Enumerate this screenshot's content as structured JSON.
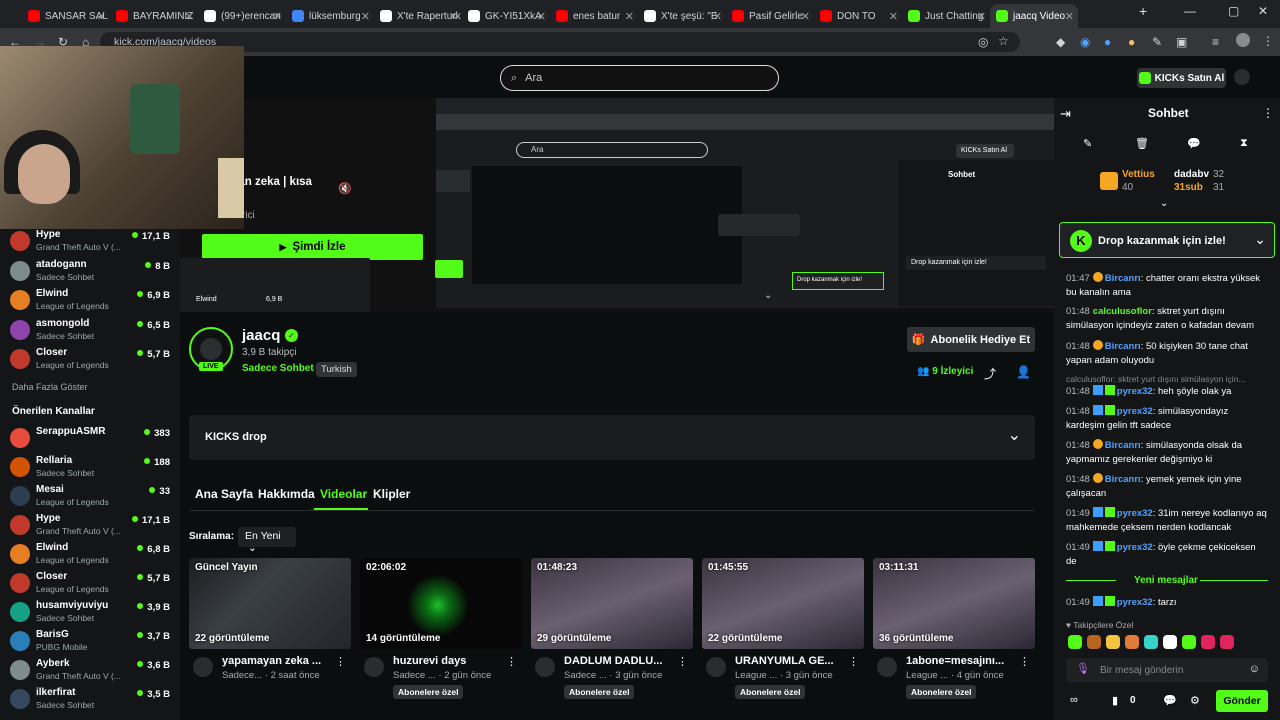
{
  "browser": {
    "tabs": [
      {
        "label": "SANSAR SAL",
        "color": "#ff0000"
      },
      {
        "label": "BAYRAMINIZ",
        "color": "#ff0000"
      },
      {
        "label": "(99+)erencan",
        "color": "#ffffff"
      },
      {
        "label": "lüksemburg",
        "color": "#4285f4"
      },
      {
        "label": "X'te Raperturk",
        "color": "#ffffff"
      },
      {
        "label": "GK-YI51XkA",
        "color": "#ffffff"
      },
      {
        "label": "enes batur",
        "color": "#ff0000"
      },
      {
        "label": "X'te şeşü: \"E",
        "color": "#ffffff"
      },
      {
        "label": "Pasif Gelirle",
        "color": "#ff0000"
      },
      {
        "label": "DON TO",
        "color": "#ff0000"
      },
      {
        "label": "Just Chatting",
        "color": "#53fc18"
      },
      {
        "label": "jaacq Video",
        "color": "#53fc18"
      }
    ],
    "url": "kick.com/jaacq/videos"
  },
  "header": {
    "search_placeholder": "Ara",
    "buy_kicks": "KICKs Satın Al"
  },
  "sidebar": {
    "followed": [
      {
        "name": "Hype",
        "game": "Grand Theft Auto V (...",
        "viewers": "17,1 B",
        "color": "#c0392b"
      },
      {
        "name": "atadogann",
        "game": "Sadece Sohbet",
        "viewers": "8 B",
        "color": "#7f8c8d"
      },
      {
        "name": "Elwind",
        "game": "League of Legends",
        "viewers": "6,9 B",
        "color": "#e67e22"
      },
      {
        "name": "asmongold",
        "game": "Sadece Sohbet",
        "viewers": "6,5 B",
        "color": "#8e44ad"
      },
      {
        "name": "Closer",
        "game": "League of Legends",
        "viewers": "5,7 B",
        "color": "#c0392b"
      }
    ],
    "show_more": "Daha Fazla Göster",
    "recommended_title": "Önerilen Kanallar",
    "recommended": [
      {
        "name": "SerappuASMR",
        "game": "",
        "viewers": "383",
        "color": "#e74c3c"
      },
      {
        "name": "Rellaria",
        "game": "Sadece Sohbet",
        "viewers": "188",
        "color": "#d35400"
      },
      {
        "name": "Mesai",
        "game": "League of Legends",
        "viewers": "33",
        "color": "#2c3e50"
      },
      {
        "name": "Hype",
        "game": "Grand Theft Auto V (...",
        "viewers": "17,1 B",
        "color": "#c0392b"
      },
      {
        "name": "Elwind",
        "game": "League of Legends",
        "viewers": "6,8 B",
        "color": "#e67e22"
      },
      {
        "name": "Closer",
        "game": "League of Legends",
        "viewers": "5,7 B",
        "color": "#c0392b"
      },
      {
        "name": "husamviyuviyu",
        "game": "Sadece Sohbet",
        "viewers": "3,9 B",
        "color": "#16a085"
      },
      {
        "name": "BarisG",
        "game": "PUBG Mobile",
        "viewers": "3,7 B",
        "color": "#2980b9"
      },
      {
        "name": "Ayberk",
        "game": "Grand Theft Auto V (...",
        "viewers": "3,6 B",
        "color": "#7f8c8d"
      },
      {
        "name": "ilkerfirat",
        "game": "Sadece Sohbet",
        "viewers": "3,5 B",
        "color": "#34495e"
      }
    ]
  },
  "player": {
    "title_partial": "yan zeka | kısa",
    "sub_partial": "rici",
    "watch_now": "Şimdi İzle"
  },
  "channel": {
    "name": "jaacq",
    "followers": "3,9 B takipçi",
    "category": "Sadece Sohbet",
    "tag": "Turkish",
    "live": "LIVE",
    "gift_sub": "Abonelik Hediye Et",
    "viewers": "9",
    "viewers_label": "İzleyici"
  },
  "drops": {
    "label": "KICKS drop"
  },
  "tabs": [
    {
      "label": "Ana Sayfa",
      "active": false
    },
    {
      "label": "Hakkımda",
      "active": false
    },
    {
      "label": "Videolar",
      "active": true
    },
    {
      "label": "Klipler",
      "active": false
    }
  ],
  "sort": {
    "label": "Sıralama:",
    "value": "En Yeni"
  },
  "videos": [
    {
      "duration": "Güncel Yayın",
      "views": "22 görüntüleme",
      "title": "yapamayan zeka ...",
      "meta": "Sadece... · 2 saat önce",
      "badge": ""
    },
    {
      "duration": "02:06:02",
      "views": "14 görüntüleme",
      "title": "huzurevi days",
      "meta": "Sadece ... · 2 gün önce",
      "badge": "Abonelere özel"
    },
    {
      "duration": "01:48:23",
      "views": "29 görüntüleme",
      "title": "DADLUM DADLU...",
      "meta": "Sadece ... · 3 gün önce",
      "badge": "Abonelere özel"
    },
    {
      "duration": "01:45:55",
      "views": "22 görüntüleme",
      "title": "URANYUMLA GE...",
      "meta": "League ... · 3 gün önce",
      "badge": "Abonelere özel"
    },
    {
      "duration": "03:11:31",
      "views": "36 görüntüleme",
      "title": "1abone=mesajını...",
      "meta": "League ... · 4 gün önce",
      "badge": "Abonelere özel"
    }
  ],
  "chat": {
    "title": "Sohbet",
    "leaders": [
      {
        "name": "Vettius",
        "value": "40"
      },
      {
        "name": "dadabv",
        "value": "32"
      },
      {
        "name": "31sub",
        "value": "31"
      }
    ],
    "drop_banner": "Drop kazanmak için izle!",
    "messages": [
      {
        "time": "01:47",
        "user": "Bircanrı",
        "text": "chatter oranı ekstra yüksek bu kanalın ama",
        "kind": "gold"
      },
      {
        "time": "01:48",
        "user": "calculusoflor",
        "text": "sktret yurt dışını simülasyon içindeyiz zaten o kafadan devam",
        "kind": "plain"
      },
      {
        "time": "01:48",
        "user": "Bircanrı",
        "text": "50 kişiyken 30 tane chat yapan adam oluyodu",
        "kind": "gold"
      },
      {
        "time": "",
        "user": "",
        "text": "calculusoflor: sktret yurt dışını simülasyon için...",
        "kind": "reply"
      },
      {
        "time": "01:48",
        "user": "pyrex32",
        "text": "heh şöyle olak ya",
        "kind": "sub"
      },
      {
        "time": "01:48",
        "user": "pyrex32",
        "text": "simülasyondayız kardeşim gelin tft sadece",
        "kind": "sub"
      },
      {
        "time": "01:48",
        "user": "Bircanrı",
        "text": "simülasyonda olsak da yapmamız gerekenler değişmiyo ki",
        "kind": "gold"
      },
      {
        "time": "01:48",
        "user": "Bircanrı",
        "text": "yemek yemek için yine çalışacan",
        "kind": "gold"
      },
      {
        "time": "01:49",
        "user": "pyrex32",
        "text": "31im nereye kodlanıyo aq mahkemede çeksem nerden kodlancak",
        "kind": "sub"
      },
      {
        "time": "01:49",
        "user": "pyrex32",
        "text": "öyle çekme çekiceksen de",
        "kind": "sub"
      }
    ],
    "new_messages": "Yeni mesajlar",
    "last_message": {
      "time": "01:49",
      "user": "pyrex32",
      "text": "tarzı"
    },
    "followers_only": "Takipçilere Özel",
    "input_placeholder": "Bir mesaj gönderin",
    "kicks_count": "0",
    "send": "Gönder"
  }
}
